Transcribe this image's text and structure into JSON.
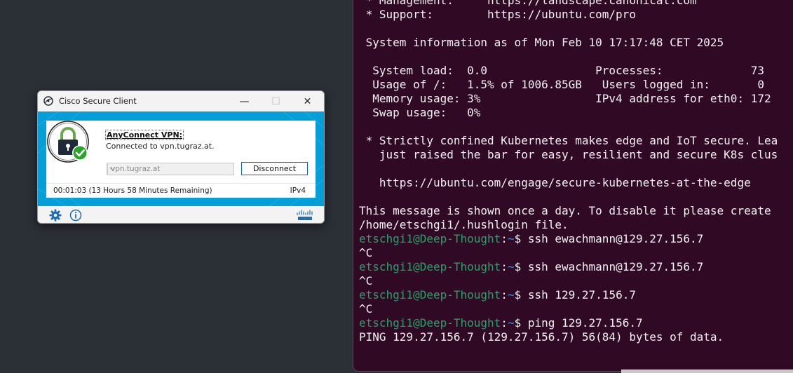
{
  "terminal": {
    "lines": [
      [
        {
          "t": " * Management:     https://landscape.canonical.com",
          "c": "text"
        }
      ],
      [
        {
          "t": " * Support:        https://ubuntu.com/pro",
          "c": "text"
        }
      ],
      [
        {
          "t": "",
          "c": "text"
        }
      ],
      [
        {
          "t": " System information as of Mon Feb 10 17:17:48 CET 2025",
          "c": "text"
        }
      ],
      [
        {
          "t": "",
          "c": "text"
        }
      ],
      [
        {
          "t": "  System load:  0.0                Processes:             73",
          "c": "text"
        }
      ],
      [
        {
          "t": "  Usage of /:   1.5% of 1006.85GB   Users logged in:       0",
          "c": "text"
        }
      ],
      [
        {
          "t": "  Memory usage: 3%                 IPv4 address for eth0: 172",
          "c": "text"
        }
      ],
      [
        {
          "t": "  Swap usage:   0%",
          "c": "text"
        }
      ],
      [
        {
          "t": "",
          "c": "text"
        }
      ],
      [
        {
          "t": " * Strictly confined Kubernetes makes edge and IoT secure. Lea",
          "c": "text"
        }
      ],
      [
        {
          "t": "   just raised the bar for easy, resilient and secure K8s clus",
          "c": "text"
        }
      ],
      [
        {
          "t": "",
          "c": "text"
        }
      ],
      [
        {
          "t": "   https://ubuntu.com/engage/secure-kubernetes-at-the-edge",
          "c": "text"
        }
      ],
      [
        {
          "t": "",
          "c": "text"
        }
      ],
      [
        {
          "t": "This message is shown once a day. To disable it please create",
          "c": "text"
        }
      ],
      [
        {
          "t": "/home/etschgi1/.hushlogin file.",
          "c": "text"
        }
      ],
      [
        {
          "t": "etschgi1@Deep-Thought",
          "c": "user"
        },
        {
          "t": ":",
          "c": "text"
        },
        {
          "t": "~",
          "c": "path"
        },
        {
          "t": "$ ssh ewachmann@129.27.156.7",
          "c": "text"
        }
      ],
      [
        {
          "t": "^C",
          "c": "text"
        }
      ],
      [
        {
          "t": "etschgi1@Deep-Thought",
          "c": "user"
        },
        {
          "t": ":",
          "c": "text"
        },
        {
          "t": "~",
          "c": "path"
        },
        {
          "t": "$ ssh ewachmann@129.27.156.7",
          "c": "text"
        }
      ],
      [
        {
          "t": "^C",
          "c": "text"
        }
      ],
      [
        {
          "t": "etschgi1@Deep-Thought",
          "c": "user"
        },
        {
          "t": ":",
          "c": "text"
        },
        {
          "t": "~",
          "c": "path"
        },
        {
          "t": "$ ssh 129.27.156.7",
          "c": "text"
        }
      ],
      [
        {
          "t": "^C",
          "c": "text"
        }
      ],
      [
        {
          "t": "etschgi1@Deep-Thought",
          "c": "user"
        },
        {
          "t": ":",
          "c": "text"
        },
        {
          "t": "~",
          "c": "path"
        },
        {
          "t": "$ ping 129.27.156.7",
          "c": "text"
        }
      ],
      [
        {
          "t": "PING 129.27.156.7 (129.27.156.7) 56(84) bytes of data.",
          "c": "text"
        }
      ]
    ]
  },
  "cisco": {
    "window_title": "Cisco Secure Client",
    "title_icon": "cisco-globe-icon",
    "window_buttons": {
      "minimize": "—",
      "maximize": "☐",
      "close": "✕"
    },
    "vpn_module_title": "AnyConnect VPN:",
    "status_text": "Connected to vpn.tugraz.at.",
    "server_value": "vpn.tugraz.at",
    "disconnect_label": "Disconnect",
    "timer_text": "00:01:03 (13 Hours 58 Minutes Remaining)",
    "ip_version": "IPv4",
    "accent_color": "#049fd9",
    "lock_status_color": "#2aa52a",
    "bottom_icons": [
      "gear-icon",
      "info-icon",
      "cisco-logo"
    ]
  }
}
